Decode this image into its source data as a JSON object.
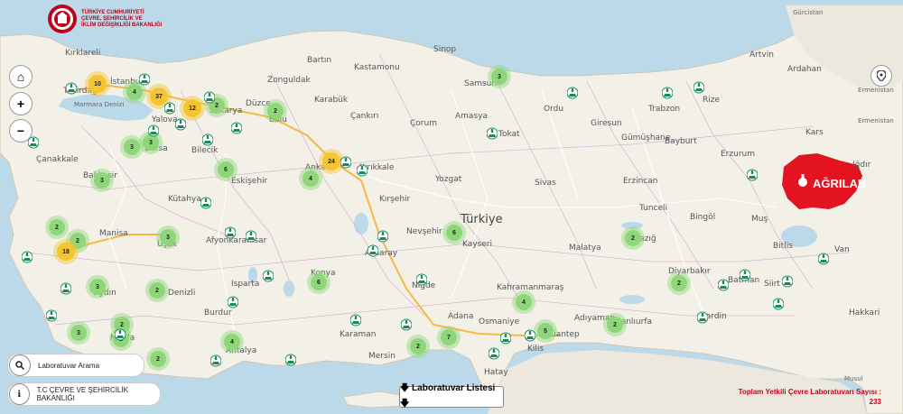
{
  "logo": {
    "line1": "TÜRKİYE CUMHURİYETİ",
    "line2": "ÇEVRE, ŞEHİRCİLİK VE",
    "line3": "İKLİM DEĞİŞİKLİĞİ BAKANLIĞI"
  },
  "controls": {
    "home": "⌂",
    "zoom_in": "+",
    "zoom_out": "−"
  },
  "search": {
    "placeholder": "Laboratuvar Arama"
  },
  "ministry_link": "T.C ÇEVRE VE ŞEHİRCİLİK BAKANLIĞI",
  "list_button": "🡇 Laboratuvar Listesi 🡇",
  "total": {
    "line1": "Toplam Yetkili Çevre Laboratuvarı Sayısı :",
    "line2": "233"
  },
  "highlight": {
    "label": "AĞRILAB",
    "color": "#e3141f"
  },
  "colors": {
    "sea": "#bcd9ea",
    "land": "#f3f0e8",
    "cluster_small": "#8fd67a",
    "cluster_large": "#f4c531",
    "marker": "#1a8a5c"
  },
  "labels": {
    "turkiye": "Türkiye",
    "gurcistan": "Gürcistan",
    "ermenistan1": "Ermenistan",
    "ermenistan2": "Ermenistan",
    "kirklareli": "Kırklareli",
    "istanbul": "İstanbul",
    "tekirdag": "Tekirdağ",
    "marmara": "Marmara Denizi",
    "canakkale": "Çanakkale",
    "balikesir": "Balıkesir",
    "bursa": "Bursa",
    "yalova": "Yalova",
    "sakarya": "Sakarya",
    "duzce": "Düzce",
    "bolu": "Bolu",
    "bilecik": "Bilecik",
    "eskisehir": "Eskişehir",
    "kutahya": "Kütahya",
    "manisa": "Manisa",
    "usak": "Uşak",
    "afyon": "Afyonkarahisar",
    "aydin": "Aydın",
    "mugla": "Muğla",
    "denizli": "Denizli",
    "isparta": "Isparta",
    "burdur": "Burdur",
    "antalya": "Antalya",
    "konya": "Konya",
    "karaman": "Karaman",
    "mersin": "Mersin",
    "adana": "Adana",
    "osmaniye": "Osmaniye",
    "hatay": "Hatay",
    "kilis": "Kilis",
    "gaziantep": "Gaziantep",
    "sanliurfa": "Şanlıurfa",
    "adiyaman": "Adıyaman",
    "kahramanmaras": "Kahramanmaraş",
    "malatya": "Malatya",
    "kayseri": "Kayseri",
    "nevsehir": "Nevşehir",
    "nigde": "Niğde",
    "aksaray": "Aksaray",
    "kirsehir": "Kırşehir",
    "ankara": "Ankara",
    "kirikkale": "Kırıkkale",
    "cankiri": "Çankırı",
    "corum": "Çorum",
    "karabuk": "Karabük",
    "bartin": "Bartın",
    "zonguldak": "Zonguldak",
    "kastamonu": "Kastamonu",
    "sinop": "Sinop",
    "samsun": "Samsun",
    "amasya": "Amasya",
    "tokat": "Tokat",
    "yozgat": "Yozgat",
    "sivas": "Sivas",
    "ordu": "Ordu",
    "giresun": "Giresun",
    "trabzon": "Trabzon",
    "rize": "Rize",
    "gumushane": "Gümüşhane",
    "bayburt": "Bayburt",
    "erzincan": "Erzincan",
    "erzurum": "Erzurum",
    "tunceli": "Tunceli",
    "elazig": "Elazığ",
    "bingol": "Bingöl",
    "mus": "Muş",
    "bitlis": "Bitlis",
    "van": "Van",
    "diyarbakir": "Diyarbakır",
    "batman": "Batman",
    "siirt": "Siirt",
    "mardin": "Mardin",
    "hakkari": "Hakkari",
    "kars": "Kars",
    "igdir": "Iğdır",
    "artvin": "Artvin",
    "ardahan": "Ardahan",
    "musul": "Musul"
  },
  "clusters": [
    {
      "n": "10"
    },
    {
      "n": "4"
    },
    {
      "n": "37"
    },
    {
      "n": "12"
    },
    {
      "n": "2"
    },
    {
      "n": "2"
    },
    {
      "n": "3"
    },
    {
      "n": "3"
    },
    {
      "n": "3"
    },
    {
      "n": "6"
    },
    {
      "n": "24"
    },
    {
      "n": "4"
    },
    {
      "n": "3"
    },
    {
      "n": "2"
    },
    {
      "n": "2"
    },
    {
      "n": "18"
    },
    {
      "n": "3"
    },
    {
      "n": "3"
    },
    {
      "n": "2"
    },
    {
      "n": "6"
    },
    {
      "n": "6"
    },
    {
      "n": "2"
    },
    {
      "n": "3"
    },
    {
      "n": "4"
    },
    {
      "n": "2"
    },
    {
      "n": "7"
    },
    {
      "n": "2"
    },
    {
      "n": "5"
    },
    {
      "n": "2"
    },
    {
      "n": "2"
    },
    {
      "n": "2"
    },
    {
      "n": "4"
    },
    {
      "n": "2"
    }
  ]
}
